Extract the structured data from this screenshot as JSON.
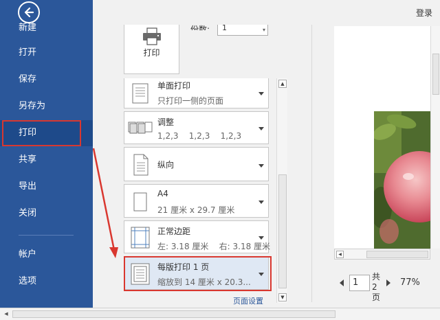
{
  "sidebar": {
    "back_icon": "back-arrow-icon",
    "items": [
      {
        "label": "新建"
      },
      {
        "label": "打开"
      },
      {
        "label": "保存"
      },
      {
        "label": "另存为"
      },
      {
        "label": "打印"
      },
      {
        "label": "共享"
      },
      {
        "label": "导出"
      },
      {
        "label": "关闭"
      },
      {
        "label": "帐户"
      },
      {
        "label": "选项"
      }
    ],
    "active_item": "打印"
  },
  "header": {
    "login": "登录"
  },
  "print": {
    "button_label": "打印",
    "copies_label": "份数:",
    "copies_value": "1"
  },
  "settings": [
    {
      "title": "单面打印",
      "subtitle": "只打印一侧的页面",
      "icon": "single-sided-icon"
    },
    {
      "title": "调整",
      "subtitle": "1,2,3    1,2,3    1,2,3",
      "icon": "collate-icon"
    },
    {
      "title": "纵向",
      "subtitle": "",
      "icon": "portrait-icon"
    },
    {
      "title": "A4",
      "subtitle": "21 厘米 x 29.7 厘米",
      "icon": "paper-size-icon"
    },
    {
      "title": "正常边距",
      "subtitle": "左: 3.18 厘米    右: 3.18 厘米",
      "icon": "margins-icon"
    },
    {
      "title": "每版打印 1 页",
      "subtitle": "缩放到 14 厘米 x 20.3...",
      "icon": "pages-per-sheet-icon"
    }
  ],
  "page_setup_link": "页面设置",
  "preview": {
    "page_input": "1",
    "page_total": "共 2 页",
    "zoom": "77%"
  },
  "colors": {
    "sidebar": "#2b579a",
    "sidebar_active": "#1e4a8a",
    "highlight_box": "#d9372f",
    "selected_setting": "#dfe8f4"
  }
}
